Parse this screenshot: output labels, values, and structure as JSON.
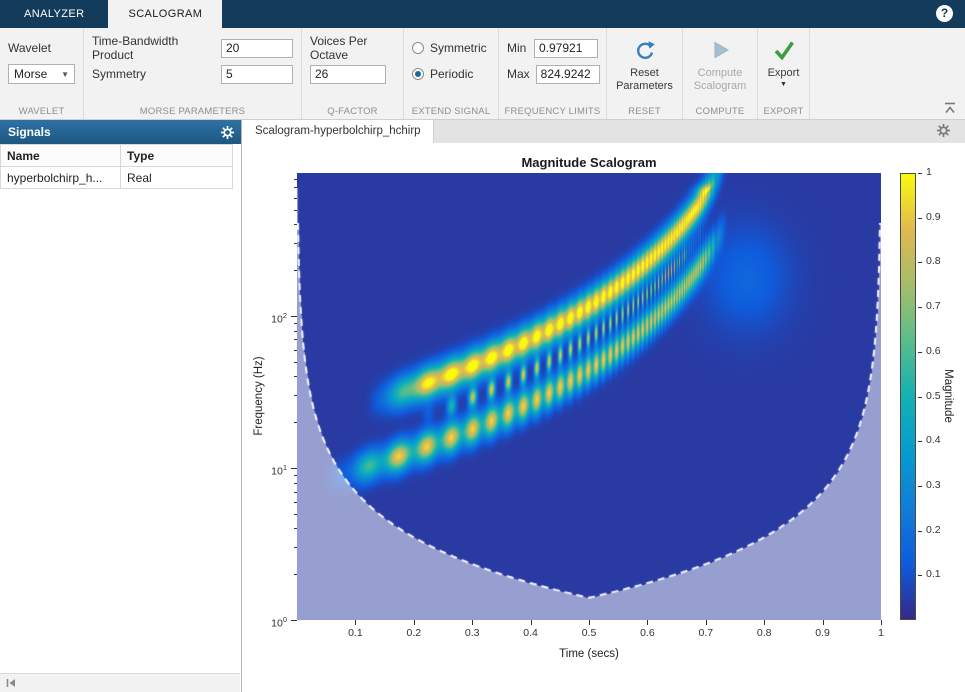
{
  "topbar": {
    "help": "?",
    "tabs": [
      {
        "label": "ANALYZER",
        "active": false
      },
      {
        "label": "SCALOGRAM",
        "active": true
      }
    ]
  },
  "toolstrip": {
    "wavelet": {
      "label": "Wavelet",
      "value": "Morse",
      "section": "WAVELET"
    },
    "morse": {
      "tbp_label": "Time-Bandwidth Product",
      "tbp_value": "20",
      "sym_label": "Symmetry",
      "sym_value": "5",
      "section": "MORSE PARAMETERS"
    },
    "qfactor": {
      "vpo_label": "Voices Per Octave",
      "vpo_value": "26",
      "section": "Q-FACTOR"
    },
    "extend": {
      "section": "EXTEND SIGNAL",
      "options": [
        {
          "label": "Symmetric",
          "selected": false
        },
        {
          "label": "Periodic",
          "selected": true
        }
      ]
    },
    "freqlimits": {
      "min_label": "Min",
      "min_value": "0.97921",
      "max_label": "Max",
      "max_value": "824.9242",
      "section": "FREQUENCY LIMITS"
    },
    "reset": {
      "label": "Reset Parameters",
      "section": "RESET"
    },
    "compute": {
      "label": "Compute Scalogram",
      "section": "COMPUTE",
      "enabled": false
    },
    "export": {
      "label": "Export",
      "section": "EXPORT"
    }
  },
  "signals_panel": {
    "title": "Signals",
    "columns": [
      "Name",
      "Type"
    ],
    "rows": [
      {
        "name": "hyperbolchirp_h...",
        "type": "Real"
      }
    ]
  },
  "document": {
    "tab": "Scalogram-hyperbolchirp_hchirp"
  },
  "colors": {
    "topbar_bg": "#133b5c",
    "panel_header_bg": "#22628f",
    "reset_icon_blue": "#3a7dbd",
    "export_icon_green": "#3f9c3f",
    "compute_icon_gray": "#a5bfd2"
  },
  "chart_data": {
    "type": "heatmap",
    "title": "Magnitude Scalogram",
    "xlabel": "Time (secs)",
    "ylabel": "Frequency (Hz)",
    "colormap": "parula",
    "xlim": [
      0,
      1
    ],
    "ylim_log10": [
      0,
      2.94
    ],
    "x_ticks": [
      0.1,
      0.2,
      0.3,
      0.4,
      0.5,
      0.6,
      0.7,
      0.8,
      0.9,
      1
    ],
    "y_tick_exponents": [
      0,
      1,
      2
    ],
    "colorbar": {
      "label": "Magnitude",
      "ticks": [
        0.1,
        0.2,
        0.3,
        0.4,
        0.5,
        0.6,
        0.7,
        0.8,
        0.9,
        1
      ]
    },
    "content_description": "CWT magnitude scalogram of a two-component hyperbolic chirp; bright ridge rises from ~10 Hz at t=0.1 s to ~800 Hz at t=0.7 s with interference dots between components; white dashed cone of influence, region outside cone shown washed out",
    "render": {
      "background_level": 0.04,
      "ridge_f0": 5.5,
      "t_singularity": 0.85,
      "harmonic_ratio": 2.6,
      "coi_k": 0.7
    }
  }
}
